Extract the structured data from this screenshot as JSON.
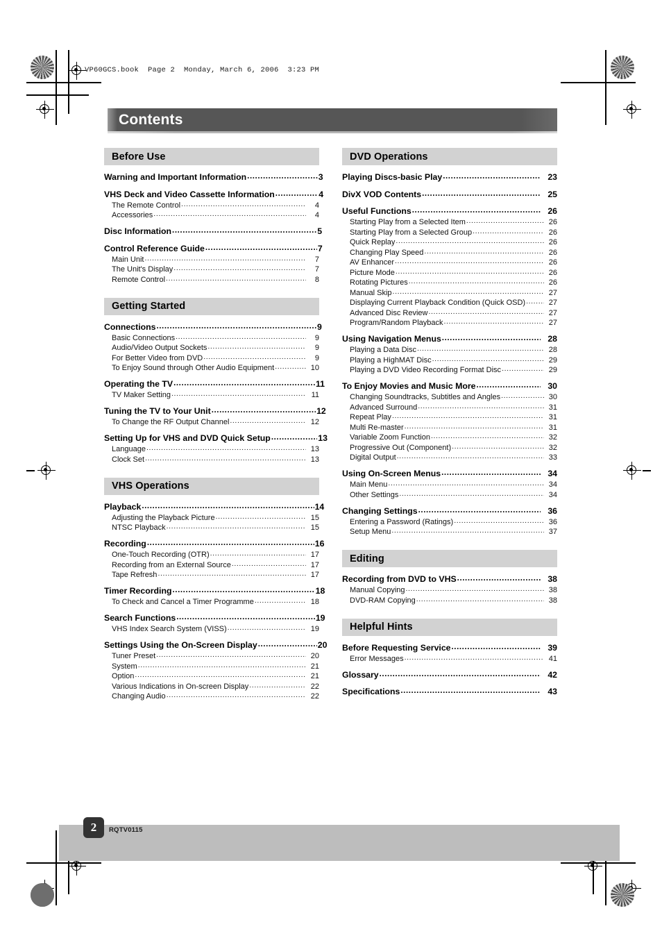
{
  "header": {
    "running_header": "VP60GCS.book  Page 2  Monday, March 6, 2006  3:23 PM",
    "title": "Contents"
  },
  "footer": {
    "page_number": "2",
    "doc_code": "RQTV0115"
  },
  "colors": {
    "title_bar": "#565656",
    "section_header": "#d2d2d2",
    "footer_band": "#bdbdbd",
    "page_badge": "#333333"
  },
  "columns": {
    "left": [
      {
        "section": "Before Use",
        "entries": [
          {
            "level": 1,
            "label": "Warning and Important Information",
            "page": "3"
          },
          {
            "level": 1,
            "label": "VHS Deck and Video Cassette Information",
            "page": "4"
          },
          {
            "level": 2,
            "label": "The Remote Control",
            "page": "4"
          },
          {
            "level": 2,
            "label": "Accessories",
            "page": "4"
          },
          {
            "level": 1,
            "label": "Disc Information",
            "page": "5"
          },
          {
            "level": 1,
            "label": "Control Reference Guide",
            "page": "7"
          },
          {
            "level": 2,
            "label": "Main Unit",
            "page": "7"
          },
          {
            "level": 2,
            "label": "The Unit's Display",
            "page": "7"
          },
          {
            "level": 2,
            "label": "Remote Control",
            "page": "8"
          }
        ]
      },
      {
        "section": "Getting Started",
        "entries": [
          {
            "level": 1,
            "label": "Connections",
            "page": "9"
          },
          {
            "level": 2,
            "label": "Basic Connections",
            "page": "9"
          },
          {
            "level": 2,
            "label": "Audio/Video Output Sockets",
            "page": "9"
          },
          {
            "level": 2,
            "label": "For Better Video from DVD",
            "page": "9"
          },
          {
            "level": 2,
            "label": "To Enjoy Sound through Other Audio Equipment",
            "page": "10"
          },
          {
            "level": 1,
            "label": "Operating the TV",
            "page": "11"
          },
          {
            "level": 2,
            "label": "TV Maker Setting",
            "page": "11"
          },
          {
            "level": 1,
            "label": "Tuning the TV to Your Unit",
            "page": "12"
          },
          {
            "level": 2,
            "label": "To Change the RF Output Channel",
            "page": "12"
          },
          {
            "level": 1,
            "label": "Setting Up for VHS and DVD Quick Setup",
            "page": "13"
          },
          {
            "level": 2,
            "label": "Language",
            "page": "13"
          },
          {
            "level": 2,
            "label": "Clock Set",
            "page": "13"
          }
        ]
      },
      {
        "section": "VHS Operations",
        "entries": [
          {
            "level": 1,
            "label": "Playback",
            "page": "14"
          },
          {
            "level": 2,
            "label": "Adjusting the Playback Picture",
            "page": "15"
          },
          {
            "level": 2,
            "label": "NTSC Playback",
            "page": "15"
          },
          {
            "level": 1,
            "label": "Recording",
            "page": "16"
          },
          {
            "level": 2,
            "label": "One-Touch Recording (OTR)",
            "page": "17"
          },
          {
            "level": 2,
            "label": "Recording from an External Source",
            "page": "17"
          },
          {
            "level": 2,
            "label": "Tape Refresh",
            "page": "17"
          },
          {
            "level": 1,
            "label": "Timer Recording",
            "page": "18"
          },
          {
            "level": 2,
            "label": "To Check and Cancel a Timer Programme",
            "page": "18"
          },
          {
            "level": 1,
            "label": "Search Functions",
            "page": "19"
          },
          {
            "level": 2,
            "label": "VHS Index Search System (VISS)",
            "page": "19"
          },
          {
            "level": 1,
            "label": "Settings Using the On-Screen Display",
            "page": "20"
          },
          {
            "level": 2,
            "label": "Tuner Preset",
            "page": "20"
          },
          {
            "level": 2,
            "label": "System",
            "page": "21"
          },
          {
            "level": 2,
            "label": "Option",
            "page": "21"
          },
          {
            "level": 2,
            "label": "Various Indications in On-screen Display",
            "page": "22"
          },
          {
            "level": 2,
            "label": "Changing Audio",
            "page": "22"
          }
        ]
      }
    ],
    "right": [
      {
        "section": "DVD Operations",
        "entries": [
          {
            "level": 1,
            "label": "Playing Discs-basic Play",
            "page": "23"
          },
          {
            "level": 1,
            "label": "DivX VOD Contents",
            "page": "25"
          },
          {
            "level": 1,
            "label": "Useful Functions",
            "page": "26"
          },
          {
            "level": 2,
            "label": "Starting Play from a Selected Item",
            "page": "26"
          },
          {
            "level": 2,
            "label": "Starting Play from a Selected Group",
            "page": "26"
          },
          {
            "level": 2,
            "label": "Quick Replay",
            "page": "26"
          },
          {
            "level": 2,
            "label": "Changing Play Speed",
            "page": "26"
          },
          {
            "level": 2,
            "label": "AV Enhancer",
            "page": "26"
          },
          {
            "level": 2,
            "label": "Picture Mode",
            "page": "26"
          },
          {
            "level": 2,
            "label": "Rotating Pictures",
            "page": "26"
          },
          {
            "level": 2,
            "label": "Manual Skip",
            "page": "27"
          },
          {
            "level": 2,
            "label": "Displaying Current Playback Condition (Quick OSD)",
            "page": "27"
          },
          {
            "level": 2,
            "label": "Advanced Disc Review",
            "page": "27"
          },
          {
            "level": 2,
            "label": "Program/Random Playback",
            "page": "27"
          },
          {
            "level": 1,
            "label": "Using Navigation Menus",
            "page": "28"
          },
          {
            "level": 2,
            "label": "Playing a Data Disc",
            "page": "28"
          },
          {
            "level": 2,
            "label": "Playing a HighMAT Disc",
            "page": "29"
          },
          {
            "level": 2,
            "label": "Playing a DVD Video Recording Format Disc",
            "page": "29"
          },
          {
            "level": 1,
            "label": "To Enjoy Movies and Music More",
            "page": "30"
          },
          {
            "level": 2,
            "label": "Changing Soundtracks, Subtitles and Angles",
            "page": "30"
          },
          {
            "level": 2,
            "label": "Advanced Surround",
            "page": "31"
          },
          {
            "level": 2,
            "label": "Repeat Play",
            "page": "31"
          },
          {
            "level": 2,
            "label": "Multi Re-master",
            "page": "31"
          },
          {
            "level": 2,
            "label": "Variable Zoom Function",
            "page": "32"
          },
          {
            "level": 2,
            "label": "Progressive Out (Component)",
            "page": "32"
          },
          {
            "level": 2,
            "label": "Digital Output",
            "page": "33"
          },
          {
            "level": 1,
            "label": "Using On-Screen Menus",
            "page": "34"
          },
          {
            "level": 2,
            "label": "Main Menu",
            "page": "34"
          },
          {
            "level": 2,
            "label": "Other Settings",
            "page": "34"
          },
          {
            "level": 1,
            "label": "Changing Settings",
            "page": "36"
          },
          {
            "level": 2,
            "label": "Entering a Password (Ratings)",
            "page": "36"
          },
          {
            "level": 2,
            "label": "Setup Menu",
            "page": "37"
          }
        ]
      },
      {
        "section": "Editing",
        "entries": [
          {
            "level": 1,
            "label": "Recording from DVD to VHS",
            "page": "38"
          },
          {
            "level": 2,
            "label": "Manual Copying",
            "page": "38"
          },
          {
            "level": 2,
            "label": "DVD-RAM Copying",
            "page": "38"
          }
        ]
      },
      {
        "section": "Helpful Hints",
        "entries": [
          {
            "level": 1,
            "label": "Before Requesting Service",
            "page": "39"
          },
          {
            "level": 2,
            "label": "Error Messages",
            "page": "41"
          },
          {
            "level": 1,
            "label": "Glossary",
            "page": "42"
          },
          {
            "level": 1,
            "label": "Specifications",
            "page": "43"
          }
        ]
      }
    ]
  }
}
